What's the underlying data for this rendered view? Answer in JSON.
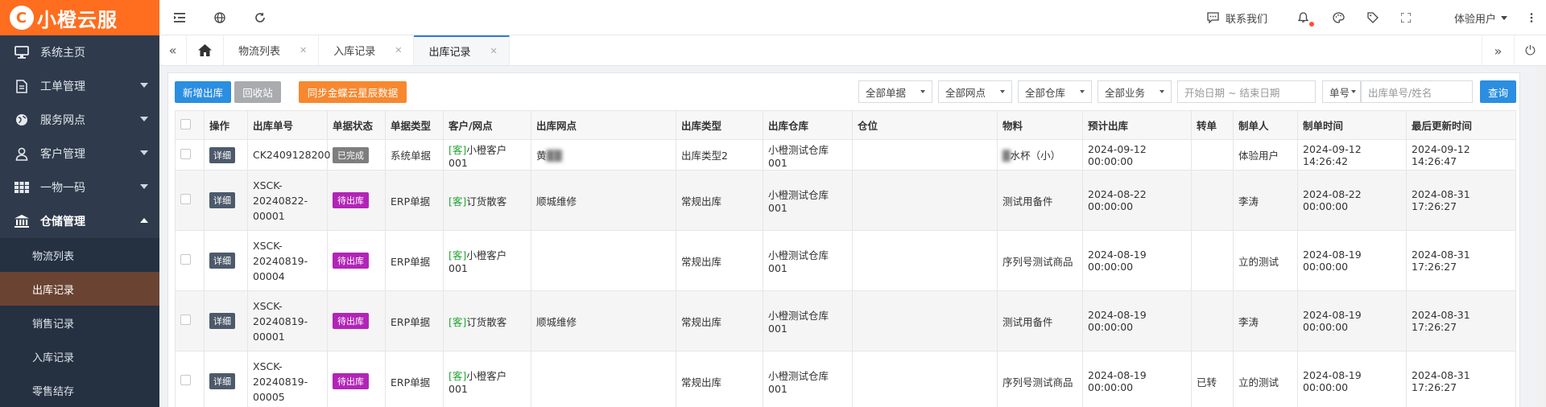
{
  "app": {
    "logo_text": "小橙云服",
    "logo_mark": "C"
  },
  "sidebar": {
    "items": [
      {
        "label": "系统主页",
        "icon": "monitor-icon"
      },
      {
        "label": "工单管理",
        "icon": "document-icon"
      },
      {
        "label": "服务网点",
        "icon": "globe-icon"
      },
      {
        "label": "客户管理",
        "icon": "user-icon"
      },
      {
        "label": "一物一码",
        "icon": "grid-icon"
      },
      {
        "label": "仓储管理",
        "icon": "bank-icon"
      }
    ],
    "subitems": [
      {
        "label": "物流列表"
      },
      {
        "label": "出库记录"
      },
      {
        "label": "销售记录"
      },
      {
        "label": "入库记录"
      },
      {
        "label": "零售结存"
      }
    ]
  },
  "topbar": {
    "contact": "联系我们",
    "user": "体验用户"
  },
  "tabs": [
    {
      "label": "物流列表"
    },
    {
      "label": "入库记录"
    },
    {
      "label": "出库记录"
    }
  ],
  "toolbar": {
    "new_out": "新增出库",
    "recycle": "回收站",
    "sync": "同步金蝶云星辰数据",
    "filters": [
      "全部单据",
      "全部网点",
      "全部仓库",
      "全部业务"
    ],
    "date_placeholder": "开始日期 ~ 结束日期",
    "search_field": "单号",
    "search_placeholder": "出库单号/姓名",
    "query": "查询"
  },
  "table": {
    "headers": [
      "操作",
      "出库单号",
      "单据状态",
      "单据类型",
      "客户/网点",
      "出库网点",
      "出库类型",
      "出库仓库",
      "仓位",
      "物料",
      "预计出库",
      "转单",
      "制单人",
      "制单时间",
      "最后更新时间"
    ],
    "action_label": "详细",
    "customer_tag": "[客]",
    "rows": [
      {
        "no": "CK2409128200",
        "status": "已完成",
        "status_color": "#7e7e7e",
        "type": "系统单据",
        "customer": "小橙客户001",
        "outlet": "黄",
        "out_type": "出库类型2",
        "warehouse": "小橙测试仓库001",
        "bin": "",
        "material": "水杯（小）",
        "expected": "2024-09-12 00:00:00",
        "transfer": "",
        "maker": "体验用户",
        "made_time": "2024-09-12 14:26:42",
        "updated": "2024-09-12 14:26:47"
      },
      {
        "no": "XSCK-20240822-00001",
        "no_lines": [
          "XSCK-",
          "20240822-",
          "00001"
        ],
        "status": "待出库",
        "status_color": "#b224b7",
        "type": "ERP单据",
        "customer": "订货散客",
        "outlet": "顺城维修",
        "out_type": "常规出库",
        "warehouse": "小橙测试仓库001",
        "bin": "",
        "material": "测试用备件",
        "expected": "2024-08-22 00:00:00",
        "transfer": "",
        "maker": "李涛",
        "made_time": "2024-08-22 00:00:00",
        "updated": "2024-08-31 17:26:27"
      },
      {
        "no": "XSCK-20240819-00004",
        "no_lines": [
          "XSCK-",
          "20240819-",
          "00004"
        ],
        "status": "待出库",
        "status_color": "#b224b7",
        "type": "ERP单据",
        "customer": "小橙客户001",
        "outlet": "",
        "out_type": "常规出库",
        "warehouse": "小橙测试仓库001",
        "bin": "",
        "material": "序列号测试商品",
        "expected": "2024-08-19 00:00:00",
        "transfer": "",
        "maker": "立的测试",
        "made_time": "2024-08-19 00:00:00",
        "updated": "2024-08-31 17:26:27"
      },
      {
        "no": "XSCK-20240819-00001",
        "no_lines": [
          "XSCK-",
          "20240819-",
          "00001"
        ],
        "status": "待出库",
        "status_color": "#b224b7",
        "type": "ERP单据",
        "customer": "订货散客",
        "outlet": "顺城维修",
        "out_type": "常规出库",
        "warehouse": "小橙测试仓库001",
        "bin": "",
        "material": "测试用备件",
        "expected": "2024-08-19 00:00:00",
        "transfer": "",
        "maker": "李涛",
        "made_time": "2024-08-19 00:00:00",
        "updated": "2024-08-31 17:26:27"
      },
      {
        "no": "XSCK-20240819-00005",
        "no_lines": [
          "XSCK-",
          "20240819-",
          "00005"
        ],
        "status": "待出库",
        "status_color": "#b224b7",
        "type": "ERP单据",
        "customer": "小橙客户001",
        "outlet": "",
        "out_type": "常规出库",
        "warehouse": "小橙测试仓库001",
        "bin": "",
        "material": "序列号测试商品",
        "expected": "2024-08-19 00:00:00",
        "transfer": "已转",
        "maker": "立的测试",
        "made_time": "2024-08-19 00:00:00",
        "updated": "2024-08-31 17:26:27"
      }
    ]
  }
}
